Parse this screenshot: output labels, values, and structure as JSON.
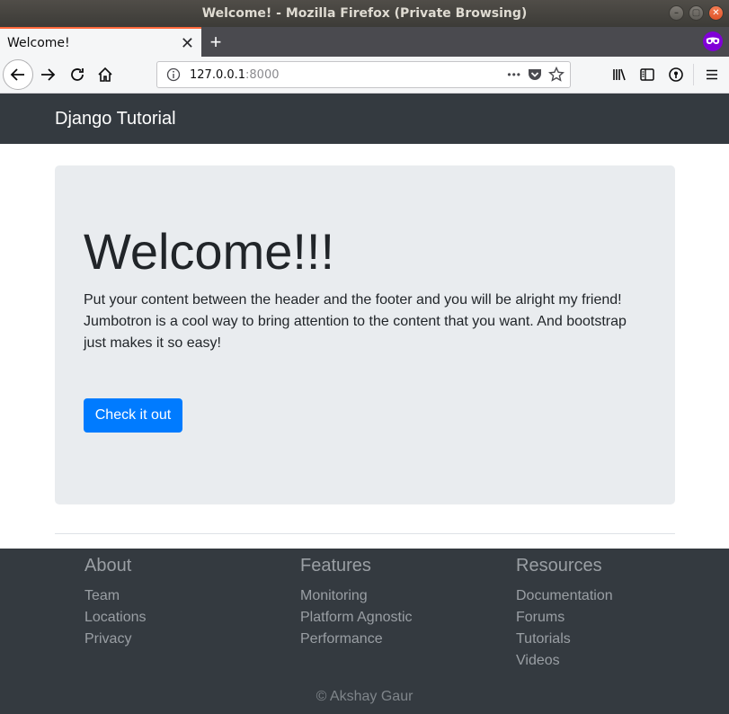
{
  "window": {
    "title": "Welcome! - Mozilla Firefox (Private Browsing)"
  },
  "browser": {
    "tab_title": "Welcome!",
    "tab_close": "✕",
    "new_tab": "+",
    "url_host": "127.0.0.1",
    "url_port": ":8000",
    "url_more": "•••"
  },
  "navbar": {
    "brand": "Django Tutorial"
  },
  "jumbotron": {
    "title": "Welcome!!!",
    "text": "Put your content between the header and the footer and you will be alright my friend! Jumbotron is a cool way to bring attention to the content that you want. And bootstrap just makes it so easy!",
    "button_label": "Check it out"
  },
  "footer": {
    "columns": [
      {
        "heading": "About",
        "links": [
          "Team",
          "Locations",
          "Privacy"
        ]
      },
      {
        "heading": "Features",
        "links": [
          "Monitoring",
          "Platform Agnostic",
          "Performance"
        ]
      },
      {
        "heading": "Resources",
        "links": [
          "Documentation",
          "Forums",
          "Tutorials",
          "Videos"
        ]
      }
    ],
    "copyright": "© Akshay Gaur"
  },
  "colors": {
    "primary": "#007bff",
    "dark": "#343a40",
    "jumbotron_bg": "#e9ecef",
    "firefox_accent": "#ff6a3d",
    "private_purple": "#8000d7"
  }
}
